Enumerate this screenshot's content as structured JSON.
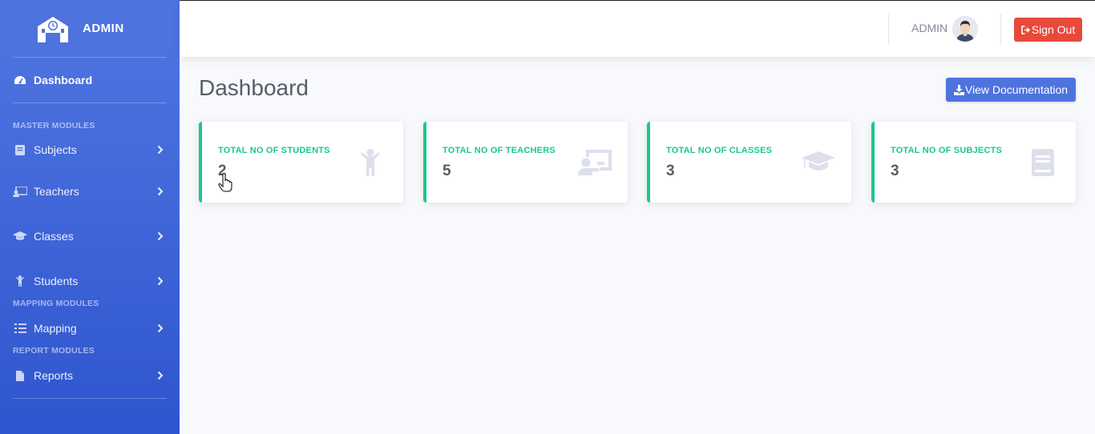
{
  "brand": {
    "title": "ADMIN"
  },
  "sidebar": {
    "dashboard": "Dashboard",
    "heading_master": "MASTER MODULES",
    "subjects": "Subjects",
    "teachers": "Teachers",
    "classes": "Classes",
    "students": "Students",
    "heading_mapping": "MAPPING MODULES",
    "mapping": "Mapping",
    "heading_report": "REPORT MODULES",
    "reports": "Reports"
  },
  "topbar": {
    "user_name": "ADMIN",
    "signout_label": "Sign Out"
  },
  "main": {
    "page_title": "Dashboard",
    "doc_button": "View Documentation"
  },
  "cards": [
    {
      "label": "TOTAL NO OF STUDENTS",
      "value": "2"
    },
    {
      "label": "TOTAL NO OF TEACHERS",
      "value": "5"
    },
    {
      "label": "TOTAL NO OF CLASSES",
      "value": "3"
    },
    {
      "label": "TOTAL NO OF SUBJECTS",
      "value": "3"
    }
  ],
  "colors": {
    "sidebar": "#4e73df",
    "accent_green": "#1cc88a",
    "danger": "#e74a3b",
    "primary": "#4e73df"
  }
}
